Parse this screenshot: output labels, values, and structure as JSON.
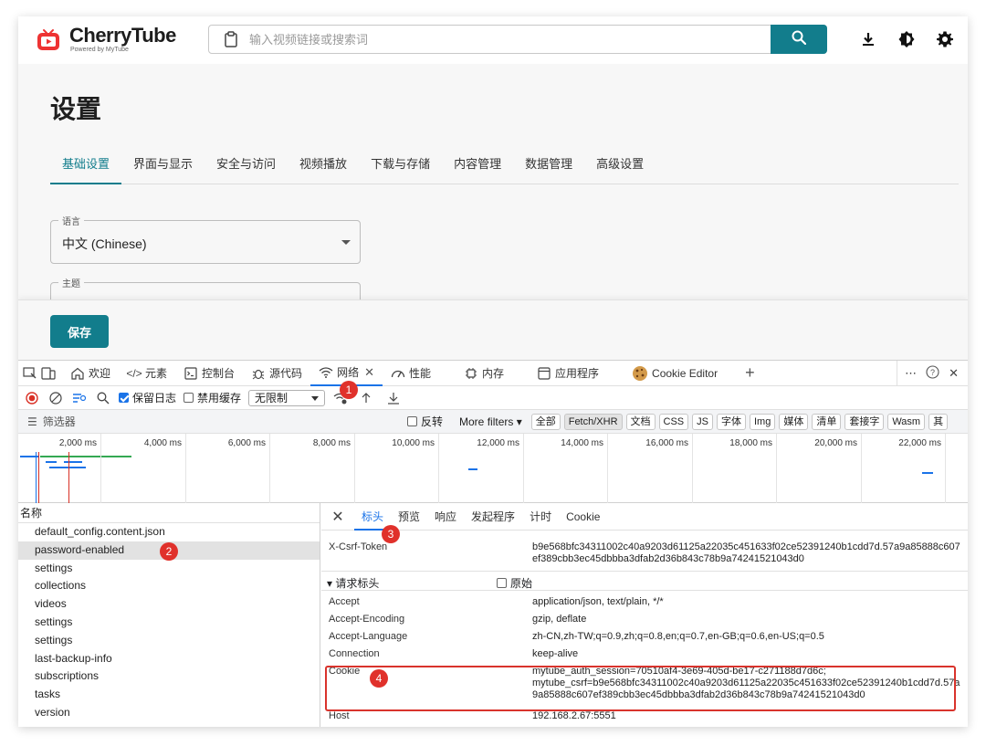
{
  "app": {
    "logo_name": "CherryTube",
    "logo_sub": "Powered by MyTube",
    "search_placeholder": "输入视频链接或搜索词",
    "page_title": "设置",
    "tabs": [
      "基础设置",
      "界面与显示",
      "安全与访问",
      "视频播放",
      "下载与存储",
      "内容管理",
      "数据管理",
      "高级设置"
    ],
    "active_tab": 0,
    "language_label": "语言",
    "language_value": "中文 (Chinese)",
    "theme_label": "主题",
    "save_label": "保存",
    "accent_color": "#127d8c"
  },
  "devtools": {
    "tabs": [
      {
        "label": "欢迎",
        "icon": "home-icon"
      },
      {
        "label": "元素",
        "icon": "code-icon"
      },
      {
        "label": "控制台",
        "icon": "console-icon"
      },
      {
        "label": "源代码",
        "icon": "bug-icon"
      },
      {
        "label": "网络",
        "icon": "wifi-icon"
      },
      {
        "label": "性能",
        "icon": "gauge-icon"
      },
      {
        "label": "内存",
        "icon": "chip-icon"
      },
      {
        "label": "应用程序",
        "icon": "window-icon"
      },
      {
        "label": "Cookie Editor",
        "icon": "cookie-icon"
      }
    ],
    "toolbar": {
      "preserve_log": "保留日志",
      "disable_cache": "禁用缓存",
      "throttle": "无限制"
    },
    "filter": {
      "placeholder": "筛选器",
      "invert": "反转",
      "more_filters": "More filters",
      "chips": [
        "全部",
        "Fetch/XHR",
        "文档",
        "CSS",
        "JS",
        "字体",
        "Img",
        "媒体",
        "清单",
        "套接字",
        "Wasm",
        "其"
      ]
    },
    "timeline_labels": [
      "2,000 ms",
      "4,000 ms",
      "6,000 ms",
      "8,000 ms",
      "10,000 ms",
      "12,000 ms",
      "14,000 ms",
      "16,000 ms",
      "18,000 ms",
      "20,000 ms",
      "22,000 ms"
    ],
    "name_header": "名称",
    "requests": [
      "default_config.content.json",
      "password-enabled",
      "settings",
      "collections",
      "videos",
      "settings",
      "settings",
      "last-backup-info",
      "subscriptions",
      "tasks",
      "version"
    ],
    "selected_request": 1,
    "detail_tabs": [
      "标头",
      "预览",
      "响应",
      "发起程序",
      "计时",
      "Cookie"
    ],
    "csrf_key": "X-Csrf-Token",
    "csrf_value": "b9e568bfc34311002c40a9203d61125a22035c451633f02ce52391240b1cdd7d.57a9a85888c607ef389cbb3ec45dbbba3dfab2d36b843c78b9a74241521043d0",
    "request_headers_title": "请求标头",
    "raw_label": "原始",
    "headers": [
      {
        "key": "Accept",
        "value": "application/json, text/plain, */*"
      },
      {
        "key": "Accept-Encoding",
        "value": "gzip, deflate"
      },
      {
        "key": "Accept-Language",
        "value": "zh-CN,zh-TW;q=0.9,zh;q=0.8,en;q=0.7,en-GB;q=0.6,en-US;q=0.5"
      },
      {
        "key": "Connection",
        "value": "keep-alive"
      }
    ],
    "cookie_key": "Cookie",
    "cookie_value_1": "mytube_auth_session=70510af4-3e69-405d-be17-c271188d7d6c;",
    "cookie_value_2": "mytube_csrf=b9e568bfc34311002c40a9203d61125a22035c451633f02ce52391240b1cdd7d.57a9a85888c607ef389cbb3ec45dbbba3dfab2d36b843c78b9a74241521043d0",
    "host_key": "Host",
    "host_value": "192.168.2.67:5551"
  },
  "annotations": [
    "1",
    "2",
    "3",
    "4"
  ],
  "annotation_color": "#e0312b"
}
